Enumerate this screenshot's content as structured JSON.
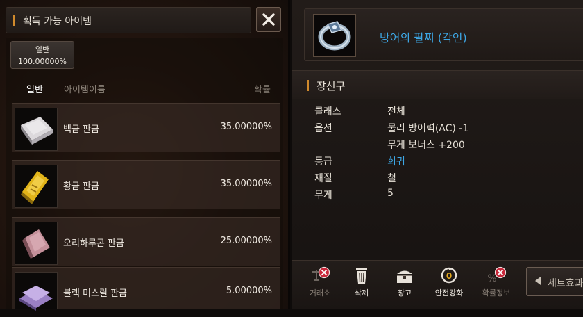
{
  "acquire_panel": {
    "title": "획득 가능 아이템",
    "category_badge": {
      "label": "일반",
      "rate": "100.00000%"
    },
    "tab_general": "일반",
    "column_name": "아이템이름",
    "column_rate": "확률",
    "items": [
      {
        "name": "백금 판금",
        "rate": "35.00000%",
        "icon": "platinum-plate-icon"
      },
      {
        "name": "황금 판금",
        "rate": "35.00000%",
        "icon": "gold-plate-icon"
      },
      {
        "name": "오리하루콘 판금",
        "rate": "25.00000%",
        "icon": "orichalcum-plate-icon"
      },
      {
        "name": "블랙 미스릴 판금",
        "rate": "5.00000%",
        "icon": "black-mithril-plate-icon"
      }
    ]
  },
  "item_detail": {
    "title": "방어의 팔찌 (각인)",
    "section": "장신구",
    "attributes": [
      {
        "label": "클래스",
        "value": "전체"
      },
      {
        "label": "옵션",
        "value": "물리 방어력(AC) -1"
      },
      {
        "label": "",
        "value": "무게 보너스 +200"
      },
      {
        "label": "등급",
        "value": "희귀"
      },
      {
        "label": "재질",
        "value": "철"
      },
      {
        "label": "무게",
        "value": "5"
      }
    ],
    "toolbar": {
      "trade": "거래소",
      "delete": "삭제",
      "warehouse": "창고",
      "safe_enhance": "안전강화",
      "probability": "확률정보",
      "set_effect": "세트효과"
    }
  },
  "colors": {
    "accent_orange": "#d08a2c",
    "title_blue": "#3da6e4",
    "forbidden_red": "#c8283a"
  }
}
